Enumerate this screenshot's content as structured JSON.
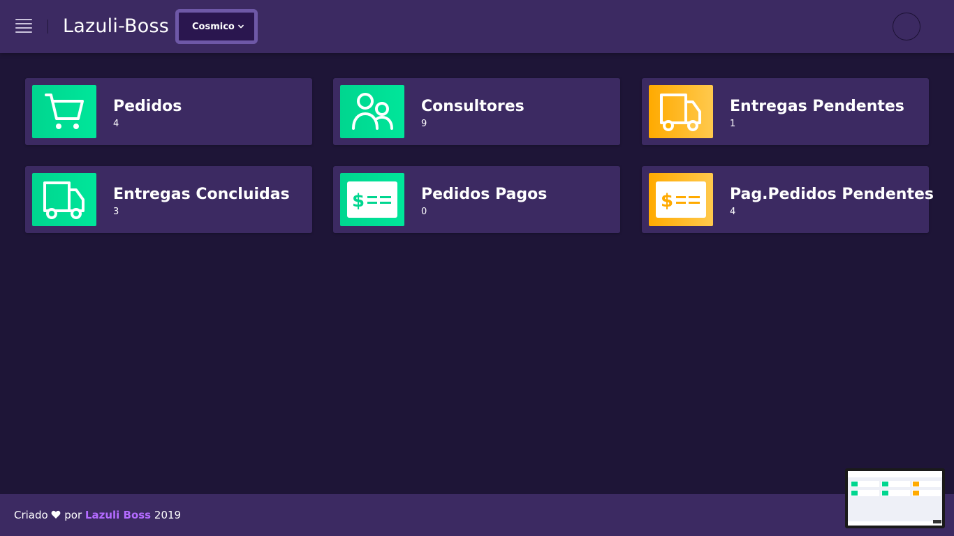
{
  "header": {
    "app_title": "Lazuli-Boss",
    "theme_select": {
      "value": "Cosmico"
    },
    "menu_icon": "hamburger-menu-icon",
    "user_icon": "avatar"
  },
  "cards": [
    {
      "title": "Pedidos",
      "count": "4",
      "icon": "shopping-cart-icon",
      "status": "success"
    },
    {
      "title": "Consultores",
      "count": "9",
      "icon": "people-icon",
      "status": "success"
    },
    {
      "title": "Entregas Pendentes",
      "count": "1",
      "icon": "truck-icon",
      "status": "warning"
    },
    {
      "title": "Entregas Concluidas",
      "count": "3",
      "icon": "truck-icon",
      "status": "success"
    },
    {
      "title": "Pedidos Pagos",
      "count": "0",
      "icon": "payment-icon",
      "status": "success"
    },
    {
      "title": "Pag.Pedidos Pendentes",
      "count": "4",
      "icon": "payment-icon",
      "status": "warning"
    }
  ],
  "footer": {
    "prefix": "Criado",
    "heart_icon": "heart-icon",
    "by": "por",
    "brand": "Lazuli Boss",
    "year": "2019"
  },
  "colors": {
    "background": "#1e1537",
    "surface": "#3c2a62",
    "success": "#00d68f",
    "warning": "#ffaa00",
    "brand_link": "#b36bff"
  }
}
